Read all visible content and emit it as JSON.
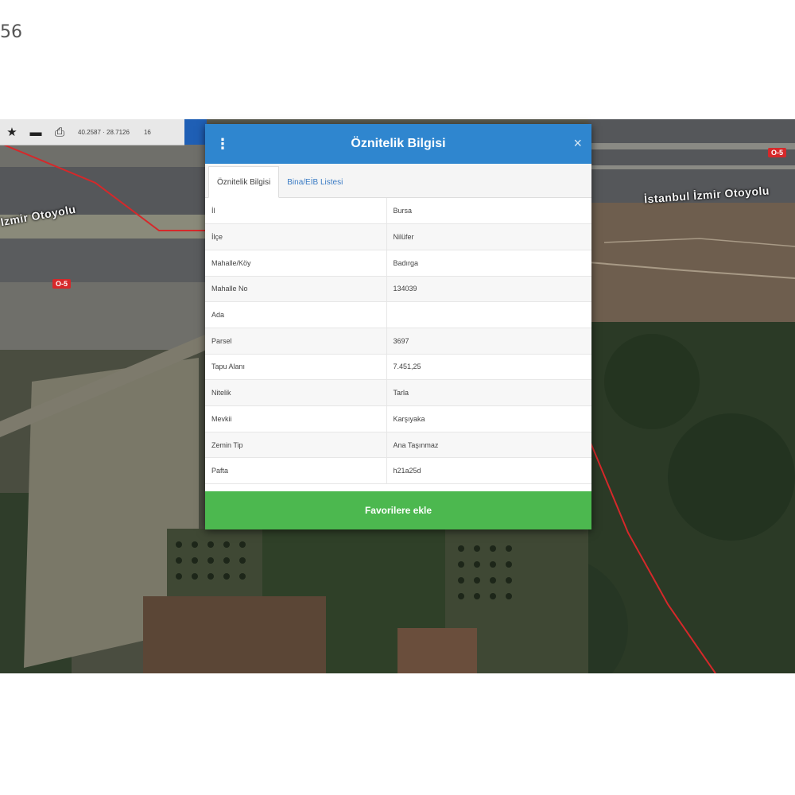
{
  "page": {
    "corner_number": "56"
  },
  "map": {
    "road_label_main": "İstanbul İzmir Otoyolu",
    "road_label_left": "Izmir Otoyolu",
    "shield_right": "O-5",
    "shield_left": "O-5",
    "boundary_color": "#d6282a"
  },
  "toolbar": {
    "star_icon": "star-icon",
    "minus_icon": "minus-icon",
    "print_icon": "printer-icon",
    "coordinates": "40.2587 · 28.7126",
    "zoom": "16"
  },
  "dialog": {
    "title": "Öznitelik Bilgisi",
    "close_glyph": "×",
    "tabs": [
      {
        "label": "Öznitelik Bilgisi"
      },
      {
        "label": "Bina/EİB Listesi"
      }
    ],
    "rows": [
      {
        "key": "İl",
        "value": "Bursa"
      },
      {
        "key": "İlçe",
        "value": "Nilüfer"
      },
      {
        "key": "Mahalle/Köy",
        "value": "Badırga"
      },
      {
        "key": "Mahalle No",
        "value": "134039"
      },
      {
        "key": "Ada",
        "value": ""
      },
      {
        "key": "Parsel",
        "value": "3697"
      },
      {
        "key": "Tapu Alanı",
        "value": "7.451,25"
      },
      {
        "key": "Nitelik",
        "value": "Tarla"
      },
      {
        "key": "Mevkii",
        "value": "Karşıyaka"
      },
      {
        "key": "Zemin Tip",
        "value": "Ana Taşınmaz"
      },
      {
        "key": "Pafta",
        "value": "h21a25d"
      }
    ],
    "favorite_button": "Favorilere ekle",
    "header_color": "#2f86cf",
    "button_color": "#4cb84f"
  }
}
